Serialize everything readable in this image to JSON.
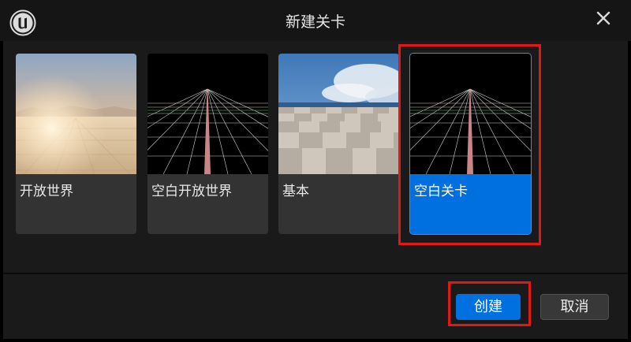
{
  "window": {
    "title": "新建关卡"
  },
  "templates": [
    {
      "label": "开放世界",
      "thumbnail": "desert-sunset-terrain",
      "selected": false
    },
    {
      "label": "空白开放世界",
      "thumbnail": "wireframe-grid-horizon",
      "selected": false
    },
    {
      "label": "基本",
      "thumbnail": "checker-floor-blue-sky",
      "selected": false
    },
    {
      "label": "空白关卡",
      "thumbnail": "wireframe-grid-horizon",
      "selected": true
    }
  ],
  "footer": {
    "create_label": "创建",
    "cancel_label": "取消"
  },
  "colors": {
    "accent": "#0070e0",
    "highlight_outline": "#e01818",
    "panel": "#1a1a1a",
    "card": "#333333"
  },
  "icons": {
    "logo": "unreal-engine-logo-icon",
    "close": "close-icon"
  }
}
